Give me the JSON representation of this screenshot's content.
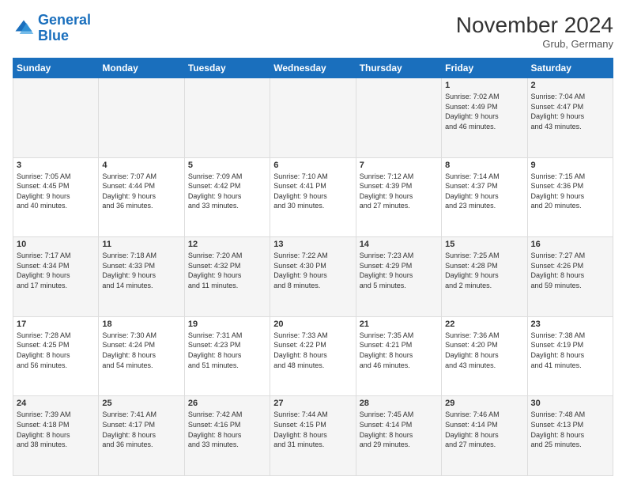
{
  "logo": {
    "line1": "General",
    "line2": "Blue"
  },
  "header": {
    "month": "November 2024",
    "location": "Grub, Germany"
  },
  "weekdays": [
    "Sunday",
    "Monday",
    "Tuesday",
    "Wednesday",
    "Thursday",
    "Friday",
    "Saturday"
  ],
  "weeks": [
    [
      {
        "day": "",
        "info": ""
      },
      {
        "day": "",
        "info": ""
      },
      {
        "day": "",
        "info": ""
      },
      {
        "day": "",
        "info": ""
      },
      {
        "day": "",
        "info": ""
      },
      {
        "day": "1",
        "info": "Sunrise: 7:02 AM\nSunset: 4:49 PM\nDaylight: 9 hours\nand 46 minutes."
      },
      {
        "day": "2",
        "info": "Sunrise: 7:04 AM\nSunset: 4:47 PM\nDaylight: 9 hours\nand 43 minutes."
      }
    ],
    [
      {
        "day": "3",
        "info": "Sunrise: 7:05 AM\nSunset: 4:45 PM\nDaylight: 9 hours\nand 40 minutes."
      },
      {
        "day": "4",
        "info": "Sunrise: 7:07 AM\nSunset: 4:44 PM\nDaylight: 9 hours\nand 36 minutes."
      },
      {
        "day": "5",
        "info": "Sunrise: 7:09 AM\nSunset: 4:42 PM\nDaylight: 9 hours\nand 33 minutes."
      },
      {
        "day": "6",
        "info": "Sunrise: 7:10 AM\nSunset: 4:41 PM\nDaylight: 9 hours\nand 30 minutes."
      },
      {
        "day": "7",
        "info": "Sunrise: 7:12 AM\nSunset: 4:39 PM\nDaylight: 9 hours\nand 27 minutes."
      },
      {
        "day": "8",
        "info": "Sunrise: 7:14 AM\nSunset: 4:37 PM\nDaylight: 9 hours\nand 23 minutes."
      },
      {
        "day": "9",
        "info": "Sunrise: 7:15 AM\nSunset: 4:36 PM\nDaylight: 9 hours\nand 20 minutes."
      }
    ],
    [
      {
        "day": "10",
        "info": "Sunrise: 7:17 AM\nSunset: 4:34 PM\nDaylight: 9 hours\nand 17 minutes."
      },
      {
        "day": "11",
        "info": "Sunrise: 7:18 AM\nSunset: 4:33 PM\nDaylight: 9 hours\nand 14 minutes."
      },
      {
        "day": "12",
        "info": "Sunrise: 7:20 AM\nSunset: 4:32 PM\nDaylight: 9 hours\nand 11 minutes."
      },
      {
        "day": "13",
        "info": "Sunrise: 7:22 AM\nSunset: 4:30 PM\nDaylight: 9 hours\nand 8 minutes."
      },
      {
        "day": "14",
        "info": "Sunrise: 7:23 AM\nSunset: 4:29 PM\nDaylight: 9 hours\nand 5 minutes."
      },
      {
        "day": "15",
        "info": "Sunrise: 7:25 AM\nSunset: 4:28 PM\nDaylight: 9 hours\nand 2 minutes."
      },
      {
        "day": "16",
        "info": "Sunrise: 7:27 AM\nSunset: 4:26 PM\nDaylight: 8 hours\nand 59 minutes."
      }
    ],
    [
      {
        "day": "17",
        "info": "Sunrise: 7:28 AM\nSunset: 4:25 PM\nDaylight: 8 hours\nand 56 minutes."
      },
      {
        "day": "18",
        "info": "Sunrise: 7:30 AM\nSunset: 4:24 PM\nDaylight: 8 hours\nand 54 minutes."
      },
      {
        "day": "19",
        "info": "Sunrise: 7:31 AM\nSunset: 4:23 PM\nDaylight: 8 hours\nand 51 minutes."
      },
      {
        "day": "20",
        "info": "Sunrise: 7:33 AM\nSunset: 4:22 PM\nDaylight: 8 hours\nand 48 minutes."
      },
      {
        "day": "21",
        "info": "Sunrise: 7:35 AM\nSunset: 4:21 PM\nDaylight: 8 hours\nand 46 minutes."
      },
      {
        "day": "22",
        "info": "Sunrise: 7:36 AM\nSunset: 4:20 PM\nDaylight: 8 hours\nand 43 minutes."
      },
      {
        "day": "23",
        "info": "Sunrise: 7:38 AM\nSunset: 4:19 PM\nDaylight: 8 hours\nand 41 minutes."
      }
    ],
    [
      {
        "day": "24",
        "info": "Sunrise: 7:39 AM\nSunset: 4:18 PM\nDaylight: 8 hours\nand 38 minutes."
      },
      {
        "day": "25",
        "info": "Sunrise: 7:41 AM\nSunset: 4:17 PM\nDaylight: 8 hours\nand 36 minutes."
      },
      {
        "day": "26",
        "info": "Sunrise: 7:42 AM\nSunset: 4:16 PM\nDaylight: 8 hours\nand 33 minutes."
      },
      {
        "day": "27",
        "info": "Sunrise: 7:44 AM\nSunset: 4:15 PM\nDaylight: 8 hours\nand 31 minutes."
      },
      {
        "day": "28",
        "info": "Sunrise: 7:45 AM\nSunset: 4:14 PM\nDaylight: 8 hours\nand 29 minutes."
      },
      {
        "day": "29",
        "info": "Sunrise: 7:46 AM\nSunset: 4:14 PM\nDaylight: 8 hours\nand 27 minutes."
      },
      {
        "day": "30",
        "info": "Sunrise: 7:48 AM\nSunset: 4:13 PM\nDaylight: 8 hours\nand 25 minutes."
      }
    ]
  ]
}
